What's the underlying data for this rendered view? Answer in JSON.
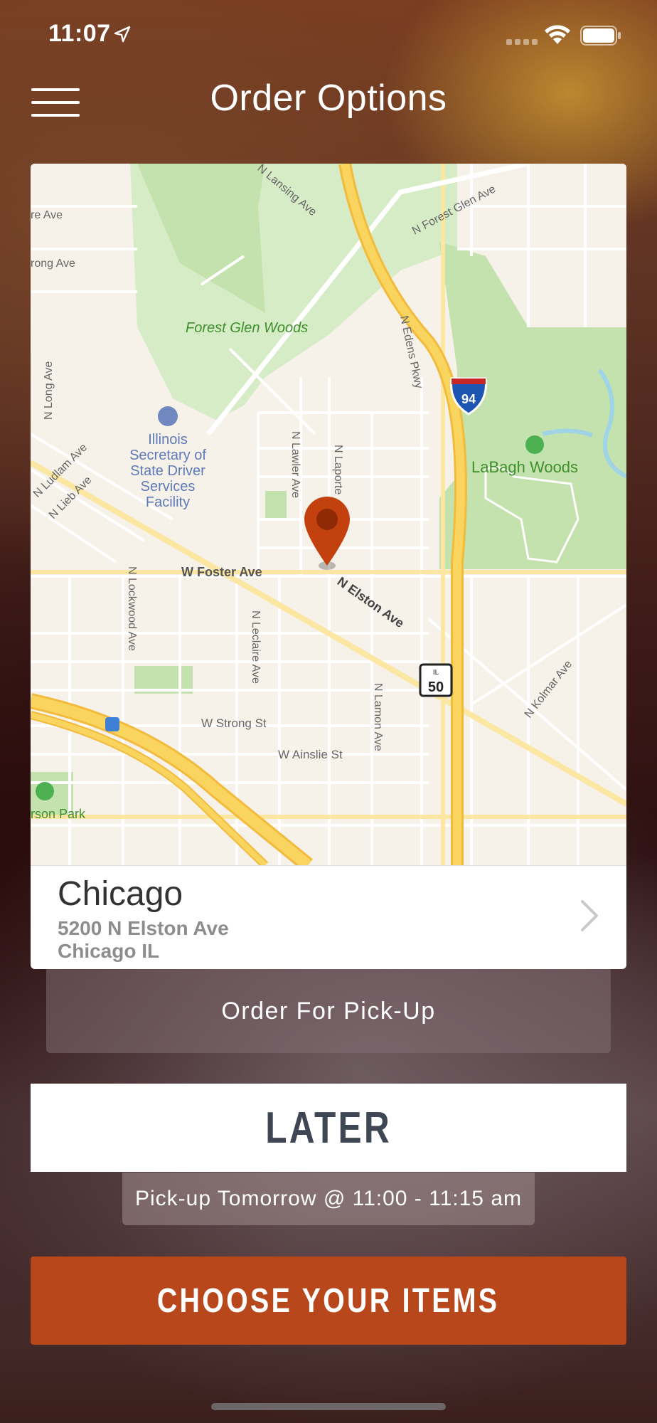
{
  "status_bar": {
    "time": "11:07"
  },
  "header": {
    "title": "Order Options"
  },
  "map": {
    "labels": {
      "forest_glen": "Forest Glen Woods",
      "lagabh": "LaBagh Woods",
      "illinois_l1": "Illinois",
      "illinois_l2": "Secretary of",
      "illinois_l3": "State Driver",
      "illinois_l4": "Services",
      "illinois_l5": "Facility",
      "w_foster": "W Foster Ave",
      "n_elston": "N Elston Ave",
      "w_strong": "W Strong St",
      "w_ainslie": "W Ainslie St",
      "n_lansing": "N Lansing Ave",
      "n_forest_glen": "N Forest Glen Ave",
      "n_edens": "N Edens Pkwy",
      "n_long": "N Long Ave",
      "n_ludlam": "N Ludlam Ave",
      "n_lieb": "N Lieb Ave",
      "n_lawler": "N Lawler Ave",
      "n_laporte": "N Laporte",
      "n_lockwood": "N Lockwood Ave",
      "n_leclaire": "N Leclaire Ave",
      "n_lamon": "N Lamon Ave",
      "n_kolmar": "N Kolmar Ave",
      "re_ave": "re Ave",
      "rong_ave": "rong Ave",
      "rson_park": "rson Park",
      "i94": "94",
      "il_state": "IL",
      "il50": "50"
    }
  },
  "location": {
    "name": "Chicago",
    "address_line1": "5200 N Elston Ave",
    "address_line2": "Chicago IL"
  },
  "order_type": {
    "label": "Order For Pick-Up"
  },
  "timing": {
    "label": "LATER"
  },
  "pickup_time": {
    "label": "Pick-up Tomorrow @ 11:00 - 11:15 am"
  },
  "cta": {
    "label": "CHOOSE YOUR ITEMS"
  },
  "colors": {
    "accent": "#b8481b",
    "pin": "#c2410e",
    "park": "#c8e6b4",
    "highway": "#f7c94a"
  }
}
